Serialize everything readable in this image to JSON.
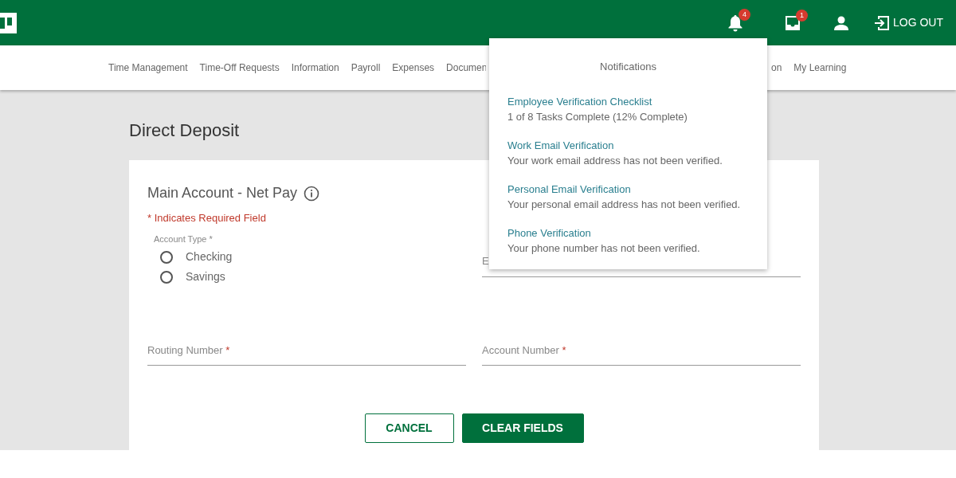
{
  "header": {
    "notification_count": "4",
    "inbox_count": "1",
    "logout": "LOG OUT"
  },
  "nav": {
    "left": [
      "Time Management",
      "Time-Off Requests",
      "Information",
      "Payroll",
      "Expenses",
      "Documen"
    ],
    "right": [
      "on",
      "My Learning"
    ]
  },
  "notifications": {
    "title": "Notifications",
    "items": [
      {
        "title": "Employee Verification Checklist",
        "text": "1 of 8 Tasks Complete (12% Complete)"
      },
      {
        "title": "Work Email Verification",
        "text": "Your work email address has not been verified."
      },
      {
        "title": "Personal Email Verification",
        "text": "Your personal email address has not been verified."
      },
      {
        "title": "Phone Verification",
        "text": "Your phone number has not been verified."
      }
    ]
  },
  "page_title": "Direct Deposit",
  "form": {
    "section_title": "Main Account - Net Pay",
    "required_note": "* Indicates Required Field",
    "account_type": {
      "label": "Account Type *",
      "options": [
        {
          "label": "Checking",
          "selected": false
        },
        {
          "label": "Savings",
          "selected": false
        }
      ]
    },
    "side_field": {
      "label": "E"
    },
    "fields": [
      {
        "label": "Routing Number",
        "mark": "*"
      },
      {
        "label": "Account Number",
        "mark": "*"
      }
    ],
    "buttons": [
      {
        "label": "CANCEL",
        "kind": "outline"
      },
      {
        "label": "CLEAR FIELDS",
        "kind": "primary"
      }
    ]
  }
}
